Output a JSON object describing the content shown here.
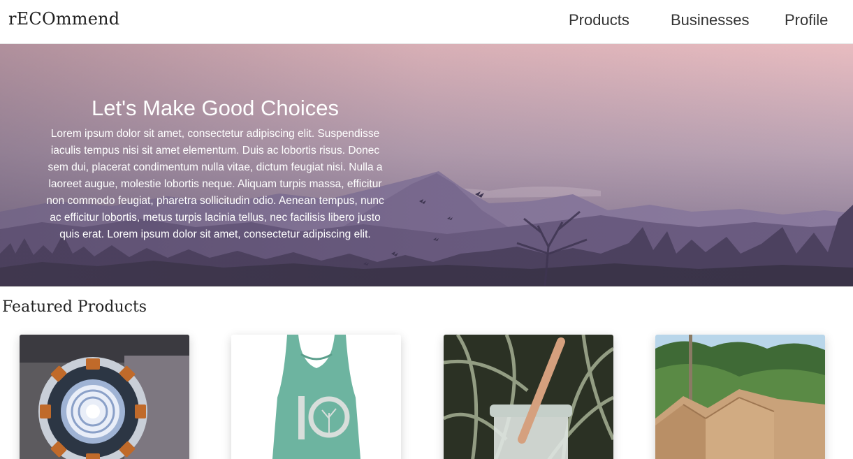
{
  "brand": "rECOmmend",
  "nav": {
    "products": "Products",
    "businesses": "Businesses",
    "profile": "Profile"
  },
  "hero": {
    "title": "Let's Make Good Choices",
    "text": "Lorem ipsum dolor sit amet, consectetur adipiscing elit. Suspendisse iaculis tempus nisi sit amet elementum. Duis ac lobortis risus. Donec sem dui, placerat condimentum nulla vitae, dictum feugiat nisi. Nulla a laoreet augue, molestie lobortis neque. Aliquam turpis massa, efficitur non commodo feugiat, pharetra sollicitudin odio. Aenean tempus, nunc ac efficitur lobortis, metus turpis lacinia tellus, nec facilisis libero justo quis erat. Lorem ipsum dolor sit amet, consectetur adipiscing elit."
  },
  "featured": {
    "heading": "Featured Products",
    "products": [
      {
        "image": "arc-reactor-image"
      },
      {
        "image": "tank-top-image"
      },
      {
        "image": "glass-jar-straw-image"
      },
      {
        "image": "cardboard-tent-image"
      }
    ]
  },
  "colors": {
    "sky_top": "#e9bcc0",
    "sky_bottom": "#8f7e96",
    "mountain": "#7a6a8e",
    "forest": "#3a3448",
    "tank_top": "#6fb5a1"
  }
}
